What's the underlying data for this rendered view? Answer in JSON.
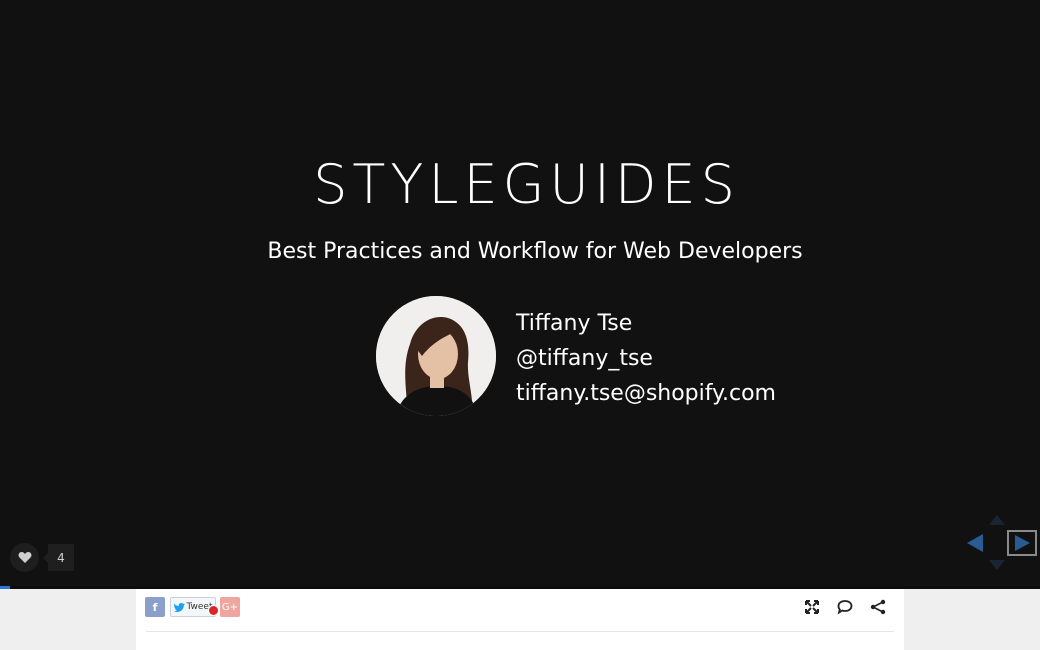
{
  "slide": {
    "title": "STYLEGUIDES",
    "subtitle": "Best Practices and Workflow for Web Developers",
    "author": {
      "name": "Tiffany Tse",
      "handle": "@tiffany_tse",
      "email": "tiffany.tse@shopify.com"
    }
  },
  "likes": {
    "count": "4",
    "icon": "heart-icon"
  },
  "navigation": {
    "icons": [
      "nav-left-icon",
      "nav-right-icon",
      "nav-up-icon",
      "nav-down-icon"
    ],
    "colors": {
      "arrow": "#2a5b93",
      "active_outline": "#8a8a8a"
    }
  },
  "progress": {
    "fraction": 0.01,
    "color": "#2a76dd"
  },
  "share": {
    "facebook_label": "f",
    "tweet_label": "Tweet",
    "google_label": "G+"
  },
  "toolbar": {
    "icons": [
      "fullscreen-icon",
      "comment-icon",
      "share-icon"
    ]
  },
  "colors": {
    "slide_background": "#111112",
    "page_background": "#efefef"
  }
}
